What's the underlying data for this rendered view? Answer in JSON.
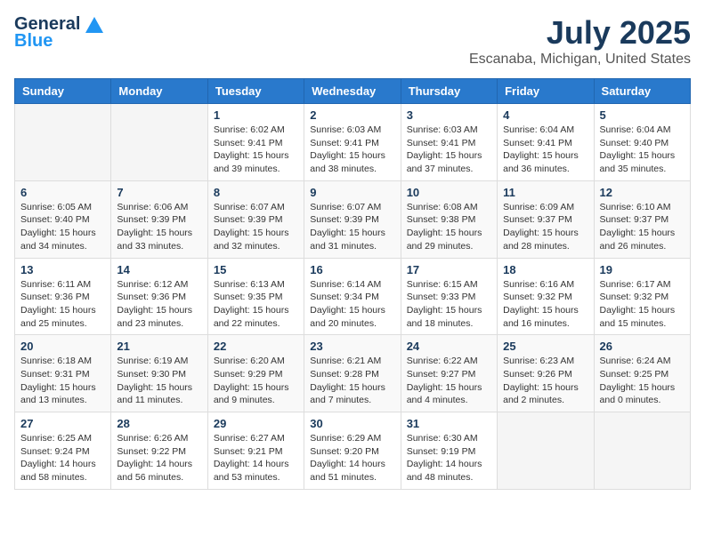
{
  "header": {
    "logo_general": "General",
    "logo_blue": "Blue",
    "month": "July 2025",
    "location": "Escanaba, Michigan, United States"
  },
  "days_of_week": [
    "Sunday",
    "Monday",
    "Tuesday",
    "Wednesday",
    "Thursday",
    "Friday",
    "Saturday"
  ],
  "weeks": [
    [
      {
        "day": "",
        "info": ""
      },
      {
        "day": "",
        "info": ""
      },
      {
        "day": "1",
        "info": "Sunrise: 6:02 AM\nSunset: 9:41 PM\nDaylight: 15 hours and 39 minutes."
      },
      {
        "day": "2",
        "info": "Sunrise: 6:03 AM\nSunset: 9:41 PM\nDaylight: 15 hours and 38 minutes."
      },
      {
        "day": "3",
        "info": "Sunrise: 6:03 AM\nSunset: 9:41 PM\nDaylight: 15 hours and 37 minutes."
      },
      {
        "day": "4",
        "info": "Sunrise: 6:04 AM\nSunset: 9:41 PM\nDaylight: 15 hours and 36 minutes."
      },
      {
        "day": "5",
        "info": "Sunrise: 6:04 AM\nSunset: 9:40 PM\nDaylight: 15 hours and 35 minutes."
      }
    ],
    [
      {
        "day": "6",
        "info": "Sunrise: 6:05 AM\nSunset: 9:40 PM\nDaylight: 15 hours and 34 minutes."
      },
      {
        "day": "7",
        "info": "Sunrise: 6:06 AM\nSunset: 9:39 PM\nDaylight: 15 hours and 33 minutes."
      },
      {
        "day": "8",
        "info": "Sunrise: 6:07 AM\nSunset: 9:39 PM\nDaylight: 15 hours and 32 minutes."
      },
      {
        "day": "9",
        "info": "Sunrise: 6:07 AM\nSunset: 9:39 PM\nDaylight: 15 hours and 31 minutes."
      },
      {
        "day": "10",
        "info": "Sunrise: 6:08 AM\nSunset: 9:38 PM\nDaylight: 15 hours and 29 minutes."
      },
      {
        "day": "11",
        "info": "Sunrise: 6:09 AM\nSunset: 9:37 PM\nDaylight: 15 hours and 28 minutes."
      },
      {
        "day": "12",
        "info": "Sunrise: 6:10 AM\nSunset: 9:37 PM\nDaylight: 15 hours and 26 minutes."
      }
    ],
    [
      {
        "day": "13",
        "info": "Sunrise: 6:11 AM\nSunset: 9:36 PM\nDaylight: 15 hours and 25 minutes."
      },
      {
        "day": "14",
        "info": "Sunrise: 6:12 AM\nSunset: 9:36 PM\nDaylight: 15 hours and 23 minutes."
      },
      {
        "day": "15",
        "info": "Sunrise: 6:13 AM\nSunset: 9:35 PM\nDaylight: 15 hours and 22 minutes."
      },
      {
        "day": "16",
        "info": "Sunrise: 6:14 AM\nSunset: 9:34 PM\nDaylight: 15 hours and 20 minutes."
      },
      {
        "day": "17",
        "info": "Sunrise: 6:15 AM\nSunset: 9:33 PM\nDaylight: 15 hours and 18 minutes."
      },
      {
        "day": "18",
        "info": "Sunrise: 6:16 AM\nSunset: 9:32 PM\nDaylight: 15 hours and 16 minutes."
      },
      {
        "day": "19",
        "info": "Sunrise: 6:17 AM\nSunset: 9:32 PM\nDaylight: 15 hours and 15 minutes."
      }
    ],
    [
      {
        "day": "20",
        "info": "Sunrise: 6:18 AM\nSunset: 9:31 PM\nDaylight: 15 hours and 13 minutes."
      },
      {
        "day": "21",
        "info": "Sunrise: 6:19 AM\nSunset: 9:30 PM\nDaylight: 15 hours and 11 minutes."
      },
      {
        "day": "22",
        "info": "Sunrise: 6:20 AM\nSunset: 9:29 PM\nDaylight: 15 hours and 9 minutes."
      },
      {
        "day": "23",
        "info": "Sunrise: 6:21 AM\nSunset: 9:28 PM\nDaylight: 15 hours and 7 minutes."
      },
      {
        "day": "24",
        "info": "Sunrise: 6:22 AM\nSunset: 9:27 PM\nDaylight: 15 hours and 4 minutes."
      },
      {
        "day": "25",
        "info": "Sunrise: 6:23 AM\nSunset: 9:26 PM\nDaylight: 15 hours and 2 minutes."
      },
      {
        "day": "26",
        "info": "Sunrise: 6:24 AM\nSunset: 9:25 PM\nDaylight: 15 hours and 0 minutes."
      }
    ],
    [
      {
        "day": "27",
        "info": "Sunrise: 6:25 AM\nSunset: 9:24 PM\nDaylight: 14 hours and 58 minutes."
      },
      {
        "day": "28",
        "info": "Sunrise: 6:26 AM\nSunset: 9:22 PM\nDaylight: 14 hours and 56 minutes."
      },
      {
        "day": "29",
        "info": "Sunrise: 6:27 AM\nSunset: 9:21 PM\nDaylight: 14 hours and 53 minutes."
      },
      {
        "day": "30",
        "info": "Sunrise: 6:29 AM\nSunset: 9:20 PM\nDaylight: 14 hours and 51 minutes."
      },
      {
        "day": "31",
        "info": "Sunrise: 6:30 AM\nSunset: 9:19 PM\nDaylight: 14 hours and 48 minutes."
      },
      {
        "day": "",
        "info": ""
      },
      {
        "day": "",
        "info": ""
      }
    ]
  ]
}
